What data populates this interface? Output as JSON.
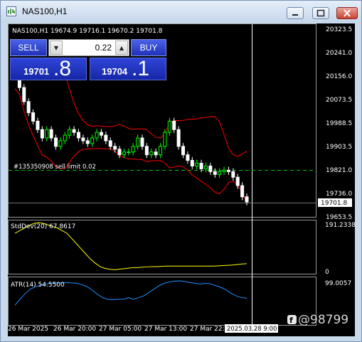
{
  "window": {
    "title": "NAS100,H1",
    "icon": "chart-window-icon"
  },
  "chart_header": "NAS100,H1  19674.9 19716.1 19670.2 19701.8",
  "trade_panel": {
    "sell_label": "SELL",
    "buy_label": "BUY",
    "volume": "0.22",
    "sell_price_small": "19701",
    "sell_price_big": ".8",
    "buy_price_small": "19704",
    "buy_price_big": ".1"
  },
  "order_line_label": "#135350908 sell limit 0.02",
  "price_axis": [
    "20323.5",
    "20241.0",
    "20156.0",
    "20073.5",
    "19988.5",
    "19903.5",
    "19821.0",
    "19736.0",
    "19653.5"
  ],
  "current_price_label": "19701.8",
  "stddev": {
    "label": "StdDev(20) 67.8617",
    "scale_max": "191.2338",
    "scale_min": "0"
  },
  "atr": {
    "label": "ATR(14) 54.5500",
    "scale_max": "99.0057"
  },
  "time_axis": [
    "26 Mar 2025",
    "26 Mar 20:00",
    "27 Mar 05:00",
    "27 Mar 13:00",
    "27 Mar 22:00"
  ],
  "crosshair_time": "2025.03.28 9:00",
  "watermark": "@98799",
  "colors": {
    "bull": "#00ff00",
    "bear": "#ffffff",
    "bands": "#ff0000",
    "stddev": "#ffff00",
    "atr": "#1e90ff",
    "order_line": "#00c000",
    "panel": "#1f31b8"
  },
  "chart_data": {
    "type": "line",
    "price_ylim": [
      19653.5,
      20323.5
    ],
    "close_series": {
      "name": "NAS100,H1",
      "values": [
        20150,
        20110,
        20060,
        20020,
        19990,
        19960,
        19930,
        19960,
        19930,
        19900,
        19920,
        19940,
        19960,
        19950,
        19930,
        19920,
        19910,
        19930,
        19950,
        19940,
        19920,
        19900,
        19890,
        19870,
        19880,
        19880,
        19900,
        19930,
        19900,
        19870,
        19880,
        19870,
        19900,
        19950,
        19990,
        19960,
        19900,
        19870,
        19850,
        19830,
        19840,
        19820,
        19830,
        19810,
        19800,
        19810,
        19815,
        19810,
        19790,
        19760,
        19720,
        19701.8
      ]
    },
    "stddev_values": [
      150,
      160,
      170,
      180,
      188,
      191,
      188,
      182,
      176,
      170,
      160,
      150,
      130,
      110,
      90,
      70,
      50,
      35,
      22,
      15,
      12,
      10,
      12,
      14,
      16,
      18,
      18,
      20,
      21,
      22,
      22,
      23,
      24,
      24,
      24,
      24,
      24,
      24,
      24,
      24,
      24,
      24,
      24,
      25,
      26,
      27,
      28,
      30,
      32,
      33
    ],
    "atr_values": [
      28,
      45,
      62,
      75,
      82,
      87,
      90,
      92,
      93,
      93,
      94,
      93,
      92,
      88,
      82,
      72,
      60,
      50,
      45,
      44,
      45,
      45,
      50,
      45,
      50,
      55,
      65,
      75,
      85,
      92,
      96,
      98,
      99,
      97,
      94,
      92,
      90,
      92,
      90,
      85,
      80,
      72,
      62,
      55,
      50,
      48
    ]
  }
}
